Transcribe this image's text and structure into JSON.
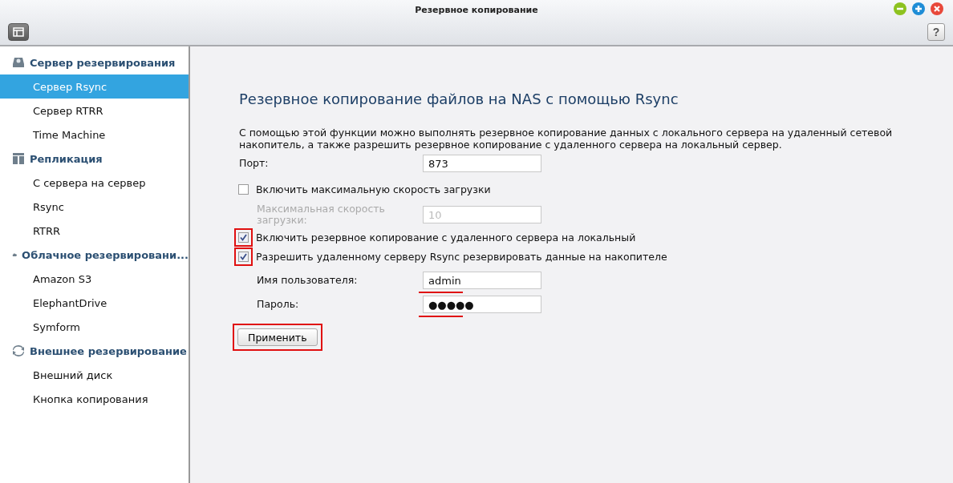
{
  "window": {
    "title": "Резервное копирование"
  },
  "toolbar": {
    "help_button": "?"
  },
  "sidebar": {
    "groups": [
      {
        "label": "Сервер резервирования",
        "items": [
          {
            "label": "Сервер Rsync",
            "selected": true
          },
          {
            "label": "Сервер RTRR",
            "selected": false
          },
          {
            "label": "Time Machine",
            "selected": false
          }
        ]
      },
      {
        "label": "Репликация",
        "items": [
          {
            "label": "С сервера на сервер",
            "selected": false
          },
          {
            "label": "Rsync",
            "selected": false
          },
          {
            "label": "RTRR",
            "selected": false
          }
        ]
      },
      {
        "label": "Облачное резервировани...",
        "items": [
          {
            "label": "Amazon S3",
            "selected": false
          },
          {
            "label": "ElephantDrive",
            "selected": false
          },
          {
            "label": "Symform",
            "selected": false
          }
        ]
      },
      {
        "label": "Внешнее резервирование",
        "items": [
          {
            "label": "Внешний диск",
            "selected": false
          },
          {
            "label": "Кнопка копирования",
            "selected": false
          }
        ]
      }
    ]
  },
  "content": {
    "heading": "Резервное копирование файлов на NAS с помощью Rsync",
    "description": "С помощью этой функции можно выполнять резервное копирование данных с локального сервера на удаленный сетевой накопитель, а также разрешить резервное копирование с удаленного сервера на локальный сервер.",
    "rows": [
      {
        "kind": "field",
        "label": "Порт:",
        "value": "873",
        "disabled": false,
        "indented": false,
        "underlined": false
      },
      {
        "kind": "checkbox",
        "label": "Включить максимальную скорость загрузки",
        "checked": false,
        "highlighted": false
      },
      {
        "kind": "field",
        "label": "Максимальная скорость загрузки:",
        "value": "10",
        "disabled": true,
        "indented": true,
        "underlined": false
      },
      {
        "kind": "checkbox",
        "label": "Включить резервное копирование с удаленного сервера на локальный",
        "checked": true,
        "highlighted": true
      },
      {
        "kind": "checkbox",
        "label": "Разрешить удаленному серверу Rsync резервировать данные на накопителе",
        "checked": true,
        "highlighted": true
      },
      {
        "kind": "field",
        "label": "Имя пользователя:",
        "value": "admin",
        "disabled": false,
        "indented": true,
        "underlined": true
      },
      {
        "kind": "field",
        "label": "Пароль:",
        "value": "●●●●●",
        "disabled": false,
        "indented": true,
        "underlined": true
      }
    ],
    "apply_button": {
      "label": "Применить",
      "highlighted": true
    }
  }
}
